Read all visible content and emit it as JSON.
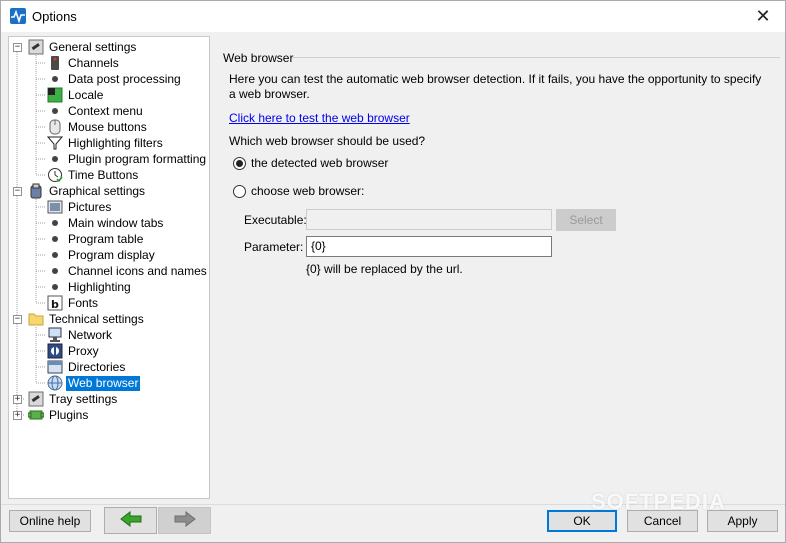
{
  "window": {
    "title": "Options"
  },
  "tree": {
    "items": [
      {
        "label": "General settings",
        "icon": "wrench-settings-icon",
        "expander": "−"
      },
      {
        "label": "Channels",
        "icon": "remote-control-icon"
      },
      {
        "label": "Data post processing",
        "icon": "bullet-icon"
      },
      {
        "label": "Locale",
        "icon": "locale-icon"
      },
      {
        "label": "Context menu",
        "icon": "bullet-icon"
      },
      {
        "label": "Mouse buttons",
        "icon": "mouse-icon"
      },
      {
        "label": "Highlighting filters",
        "icon": "funnel-icon"
      },
      {
        "label": "Plugin program formatting",
        "icon": "bullet-icon"
      },
      {
        "label": "Time Buttons",
        "icon": "clock-icon"
      },
      {
        "label": "Graphical settings",
        "icon": "paint-icon",
        "expander": "−"
      },
      {
        "label": "Pictures",
        "icon": "picture-icon"
      },
      {
        "label": "Main window tabs",
        "icon": "bullet-icon"
      },
      {
        "label": "Program table",
        "icon": "bullet-icon"
      },
      {
        "label": "Program display",
        "icon": "bullet-icon"
      },
      {
        "label": "Channel icons and names",
        "icon": "bullet-icon"
      },
      {
        "label": "Highlighting",
        "icon": "bullet-icon"
      },
      {
        "label": "Fonts",
        "icon": "font-icon"
      },
      {
        "label": "Technical settings",
        "icon": "folder-icon",
        "expander": "−"
      },
      {
        "label": "Network",
        "icon": "network-icon"
      },
      {
        "label": "Proxy",
        "icon": "proxy-icon"
      },
      {
        "label": "Directories",
        "icon": "directory-icon"
      },
      {
        "label": "Web browser",
        "icon": "globe-icon",
        "selected": true
      },
      {
        "label": "Tray settings",
        "icon": "wrench-settings-icon",
        "expander": "+"
      },
      {
        "label": "Plugins",
        "icon": "plugin-icon",
        "expander": "+"
      }
    ]
  },
  "panel": {
    "title": "Web browser",
    "description": "Here you can test the automatic web browser detection. If it fails, you have the opportunity to specify a web browser.",
    "test_link": "Click here to test the web browser",
    "question": "Which web browser should be used?",
    "option_detected": "the detected web browser",
    "option_choose": "choose web browser:",
    "selected_option": "detected",
    "executable_label": "Executable:",
    "executable_value": "",
    "select_button": "Select",
    "parameter_label": "Parameter:",
    "parameter_value": "{0}",
    "hint": "{0} will be replaced by the url."
  },
  "footer": {
    "online_help": "Online help",
    "back_icon": "green-left-arrow-icon",
    "forward_icon": "gray-right-arrow-icon",
    "ok": "OK",
    "cancel": "Cancel",
    "apply": "Apply"
  },
  "watermark": "SOFTPEDIA",
  "colors": {
    "selection": "#0078d7",
    "link": "#0000ee",
    "back_arrow": "#3aa52b",
    "forward_arrow": "#8c8c8c"
  }
}
